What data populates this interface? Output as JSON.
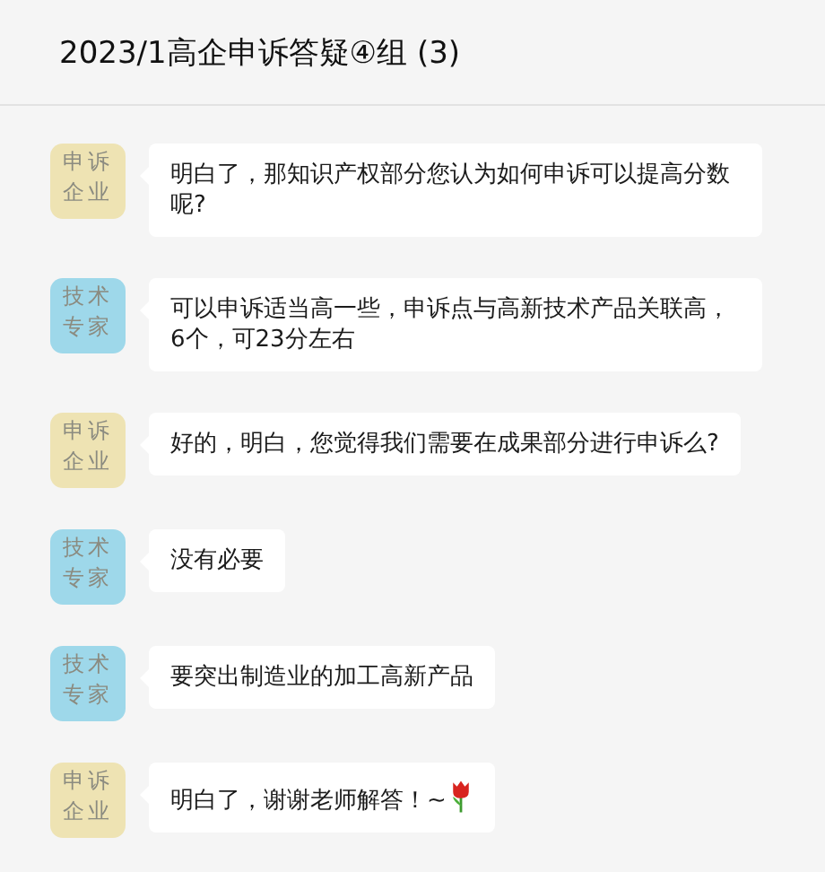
{
  "header": {
    "title": "2023/1高企申诉答疑④组 (3)"
  },
  "messages": [
    {
      "kind": "plain",
      "avatar_label": "申诉企业",
      "color": "#eee3b3",
      "text": "明白了，那知识产权部分您认为如何申诉可以提高分数呢?"
    },
    {
      "kind": "plain",
      "avatar_label": "技术专家",
      "color": "#9ed8ea",
      "text": "可以申诉适当高一些，申诉点与高新技术产品关联高，6个，可23分左右"
    },
    {
      "kind": "plain",
      "avatar_label": "申诉企业",
      "color": "#eee3b3",
      "text": "好的，明白，您觉得我们需要在成果部分进行申诉么?"
    },
    {
      "kind": "plain",
      "avatar_label": "技术专家",
      "color": "#9ed8ea",
      "text": "没有必要"
    },
    {
      "kind": "plain",
      "avatar_label": "技术专家",
      "color": "#9ed8ea",
      "text": "要突出制造业的加工高新产品"
    },
    {
      "kind": "with_icon",
      "avatar_label": "申诉企业",
      "color": "#eee3b3",
      "text": "明白了，谢谢老师解答！~"
    }
  ]
}
